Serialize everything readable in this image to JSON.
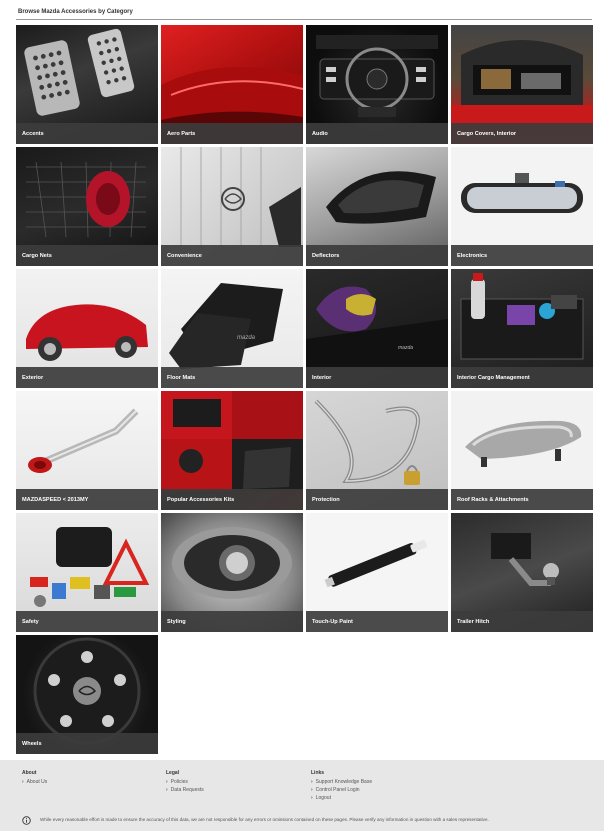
{
  "heading": "Browse Mazda Accessories by Category",
  "categories": [
    {
      "label": "Accents"
    },
    {
      "label": "Aero Parts"
    },
    {
      "label": "Audio"
    },
    {
      "label": "Cargo Covers, Interior"
    },
    {
      "label": "Cargo Nets"
    },
    {
      "label": "Convenience"
    },
    {
      "label": "Deflectors"
    },
    {
      "label": "Electronics"
    },
    {
      "label": "Exterior"
    },
    {
      "label": "Floor Mats"
    },
    {
      "label": "Interior"
    },
    {
      "label": "Interior Cargo Management"
    },
    {
      "label": "MAZDASPEED < 2013MY"
    },
    {
      "label": "Popular Accessories Kits"
    },
    {
      "label": "Protection"
    },
    {
      "label": "Roof Racks & Attachments"
    },
    {
      "label": "Safety"
    },
    {
      "label": "Styling"
    },
    {
      "label": "Touch-Up Paint"
    },
    {
      "label": "Trailer Hitch"
    },
    {
      "label": "Wheels"
    }
  ],
  "footer": {
    "about": {
      "heading": "About",
      "links": [
        "About Us"
      ]
    },
    "legal": {
      "heading": "Legal",
      "links": [
        "Policies",
        "Data Requests"
      ]
    },
    "links": {
      "heading": "Links",
      "links": [
        "Support Knowledge Base",
        "Control Panel Login",
        "Logout"
      ]
    },
    "disclaimer": "While every reasonable effort is made to ensure the accuracy of this data, we are not responsible for any errors or omissions contained on these pages. Please verify any information in question with a sales representative.",
    "info_icon": "info-circle-icon"
  }
}
